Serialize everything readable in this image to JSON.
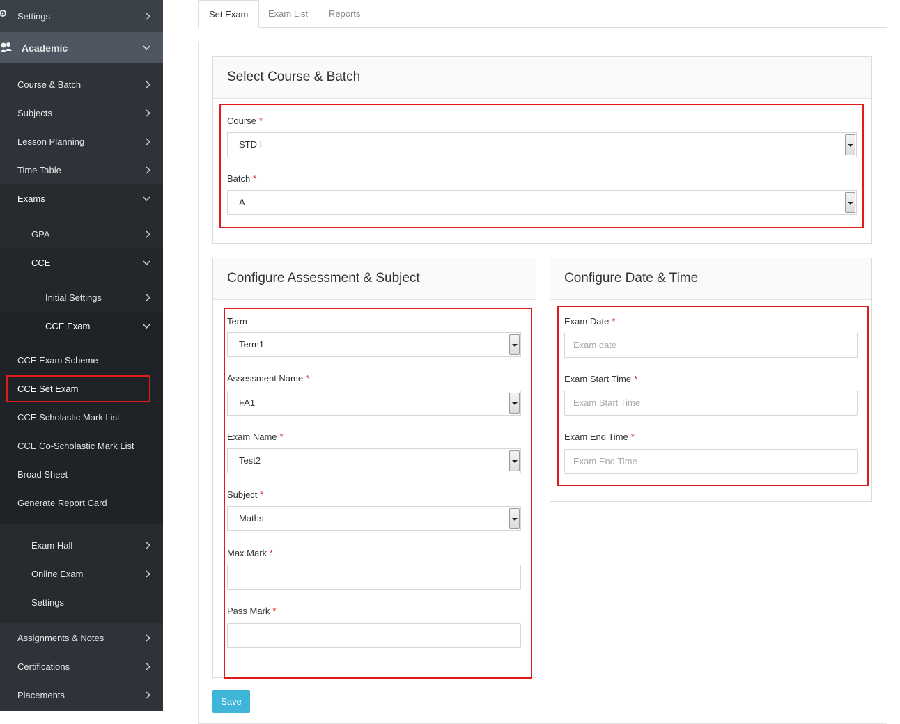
{
  "sidebar": {
    "settings": "Settings",
    "academic": "Academic",
    "course_batch": "Course & Batch",
    "subjects": "Subjects",
    "lesson_planning": "Lesson Planning",
    "time_table": "Time Table",
    "exams": "Exams",
    "gpa": "GPA",
    "cce": "CCE",
    "initial_settings": "Initial Settings",
    "cce_exam": "CCE Exam",
    "cce_exam_scheme": "CCE Exam Scheme",
    "cce_set_exam": "CCE Set Exam",
    "cce_scholastic_mark_list": "CCE Scholastic Mark List",
    "cce_co_scholastic_mark_list": "CCE Co-Scholastic Mark List",
    "broad_sheet": "Broad Sheet",
    "generate_report_card": "Generate Report Card",
    "exam_hall": "Exam Hall",
    "online_exam": "Online Exam",
    "exam_settings": "Settings",
    "assignments_notes": "Assignments & Notes",
    "certifications": "Certifications",
    "placements": "Placements"
  },
  "tabs": {
    "set_exam": "Set Exam",
    "exam_list": "Exam List",
    "reports": "Reports"
  },
  "course_batch_card": {
    "title": "Select Course & Batch",
    "course_label": "Course",
    "course_value": "STD I",
    "batch_label": "Batch",
    "batch_value": "A"
  },
  "assessment_card": {
    "title": "Configure Assessment & Subject",
    "term_label": "Term",
    "term_value": "Term1",
    "assessment_label": "Assessment Name",
    "assessment_value": "FA1",
    "exam_name_label": "Exam Name",
    "exam_name_value": "Test2",
    "subject_label": "Subject",
    "subject_value": "Maths",
    "max_mark_label": "Max.Mark",
    "max_mark_value": "",
    "pass_mark_label": "Pass Mark",
    "pass_mark_value": ""
  },
  "datetime_card": {
    "title": "Configure Date & Time",
    "exam_date_label": "Exam Date",
    "exam_date_placeholder": "Exam date",
    "start_time_label": "Exam Start Time",
    "start_time_placeholder": "Exam Start Time",
    "end_time_label": "Exam End Time",
    "end_time_placeholder": "Exam End Time"
  },
  "required_marker": "*",
  "save_label": "Save",
  "colors": {
    "sidebar_bg": "#2d3339",
    "academic_bg": "#4d5661",
    "highlight_red": "#e01b1b",
    "save_button": "#3fb5d9"
  }
}
